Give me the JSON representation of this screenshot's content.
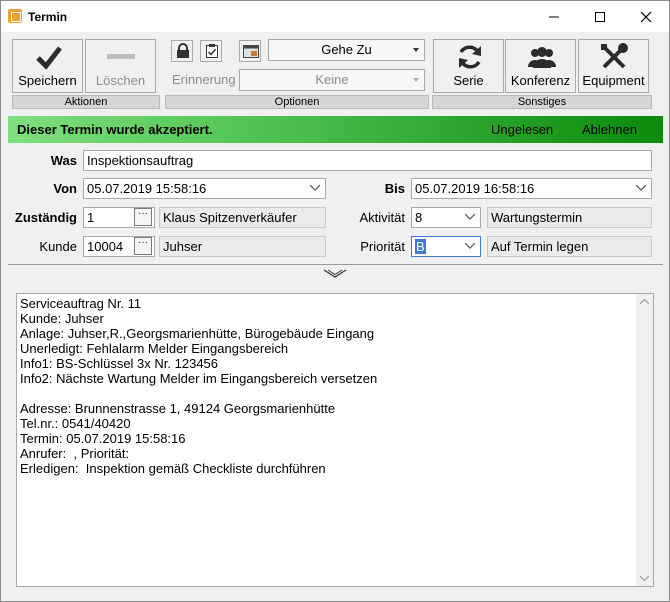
{
  "window": {
    "title": "Termin"
  },
  "ribbon": {
    "save_label": "Speichern",
    "delete_label": "Löschen",
    "group_actions": "Aktionen",
    "reminder_label": "Erinnerung",
    "goto_value": "Gehe Zu",
    "reminder_value": "Keine",
    "group_options": "Optionen",
    "series_label": "Serie",
    "conference_label": "Konferenz",
    "equipment_label": "Equipment",
    "group_other": "Sonstiges"
  },
  "status": {
    "message": "Dieser Termin wurde akzeptiert.",
    "unread_link": "Ungelesen",
    "reject_link": "Ablehnen",
    "colors": {
      "start": "#7ee07e",
      "end": "#0b8a0b"
    }
  },
  "form": {
    "was_label": "Was",
    "was_value": "Inspektionsauftrag",
    "von_label": "Von",
    "von_value": "05.07.2019 15:58:16",
    "bis_label": "Bis",
    "bis_value": "05.07.2019 16:58:16",
    "assigned_label": "Zuständig",
    "assigned_id": "1",
    "assigned_name": "Klaus Spitzenverkäufer",
    "activity_label": "Aktivität",
    "activity_value": "8",
    "activity_name": "Wartungstermin",
    "customer_label": "Kunde",
    "customer_id": "10004",
    "customer_name": "Juhser",
    "priority_label": "Priorität",
    "priority_value": "B",
    "priority_name": "Auf Termin legen"
  },
  "memo": {
    "text": "Serviceauftrag Nr. 11\nKunde: Juhser\nAnlage: Juhser,R.,Georgsmarienhütte, Bürogebäude Eingang\nUnerledigt: Fehlalarm Melder Eingangsbereich\nInfo1: BS-Schlüssel 3x Nr. 123456\nInfo2: Nächste Wartung Melder im Eingangsbereich versetzen\n\nAdresse: Brunnenstrasse 1, 49124 Georgsmarienhütte\nTel.nr.: 0541/40420\nTermin: 05.07.2019 15:58:16\nAnrufer:  , Priorität: \nErledigen:  Inspektion gemäß Checkliste durchführen"
  }
}
